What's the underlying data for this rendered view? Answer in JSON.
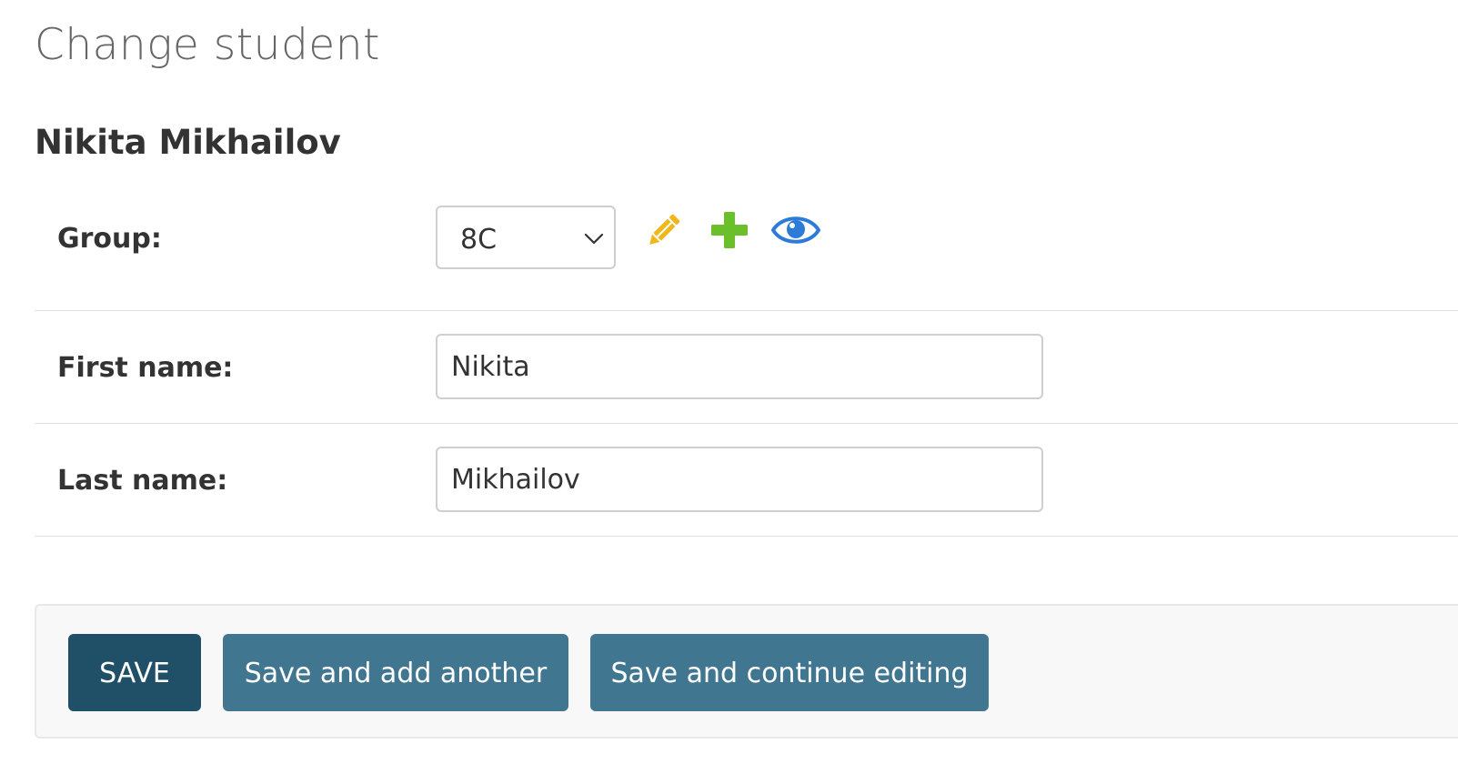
{
  "page": {
    "title": "Change student",
    "object_name": "Nikita Mikhailov"
  },
  "form": {
    "group": {
      "label": "Group:",
      "selected": "8C",
      "icons": [
        "pencil-icon",
        "plus-icon",
        "eye-icon"
      ]
    },
    "first_name": {
      "label": "First name:",
      "value": "Nikita"
    },
    "last_name": {
      "label": "Last name:",
      "value": "Mikhailov"
    }
  },
  "submit": {
    "save_label": "SAVE",
    "save_add_label": "Save and add another",
    "save_continue_label": "Save and continue editing"
  },
  "colors": {
    "primary_button": "#205067",
    "secondary_button": "#417690",
    "pencil": "#f0b71b",
    "plus": "#6bbf2a",
    "eye": "#2d7bd8"
  }
}
